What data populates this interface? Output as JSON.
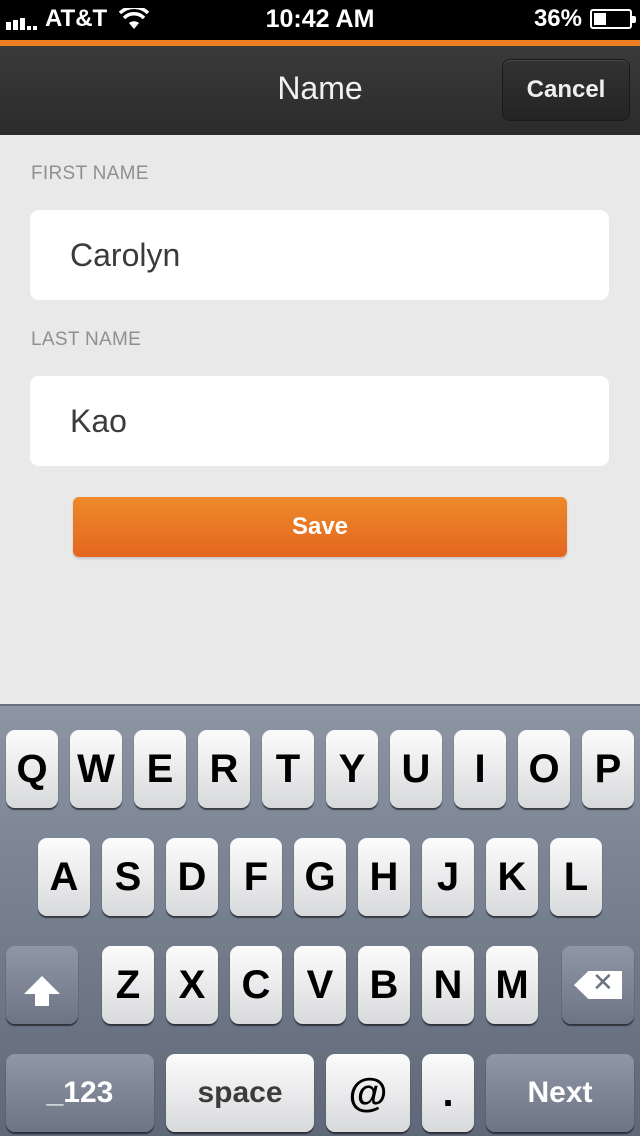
{
  "status": {
    "carrier": "AT&T",
    "time": "10:42 AM",
    "battery": "36%",
    "battery_level": 0.36
  },
  "nav": {
    "title": "Name",
    "cancel_label": "Cancel"
  },
  "form": {
    "first_name_label": "FIRST NAME",
    "first_name_value": "Carolyn",
    "last_name_label": "LAST NAME",
    "last_name_value": "Kao",
    "save_label": "Save"
  },
  "keyboard": {
    "row1": [
      "Q",
      "W",
      "E",
      "R",
      "T",
      "Y",
      "U",
      "I",
      "O",
      "P"
    ],
    "row2": [
      "A",
      "S",
      "D",
      "F",
      "G",
      "H",
      "J",
      "K",
      "L"
    ],
    "row3": [
      "Z",
      "X",
      "C",
      "V",
      "B",
      "N",
      "M"
    ],
    "numbers_label": "_123",
    "space_label": "space",
    "at_label": "@",
    "dot_label": ".",
    "next_label": "Next"
  },
  "colors": {
    "accent": "#ef7d22",
    "nav_bg": "#2f2f2f",
    "page_bg": "#e9e9e9"
  }
}
